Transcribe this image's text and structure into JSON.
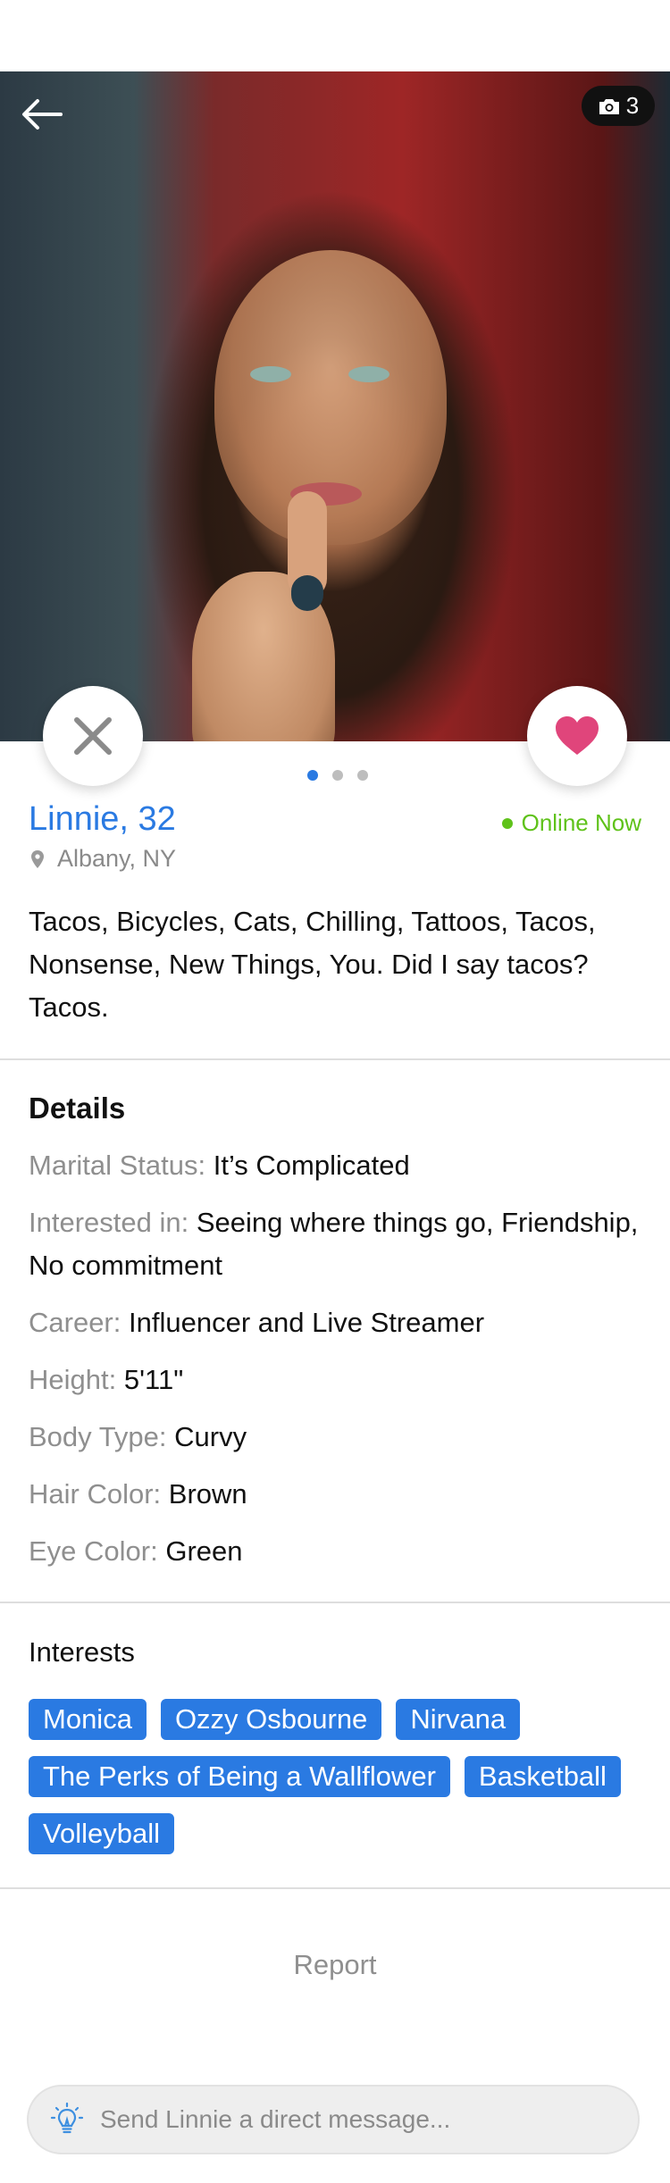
{
  "photo": {
    "count": "3",
    "current_index": 1,
    "total": 3
  },
  "profile": {
    "name_age": "Linnie, 32",
    "status": "Online Now",
    "location": "Albany, NY",
    "bio": "Tacos, Bicycles, Cats, Chilling, Tattoos, Tacos, Nonsense, New Things, You. Did I say tacos? Tacos."
  },
  "details": {
    "title": "Details",
    "items": [
      {
        "label": "Marital Status:",
        "value": "It’s Complicated"
      },
      {
        "label": "Interested in:",
        "value": "Seeing where things go, Friendship, No commitment"
      },
      {
        "label": "Career:",
        "value": "Influencer and Live Streamer"
      },
      {
        "label": "Height:",
        "value": "5'11\""
      },
      {
        "label": "Body Type:",
        "value": "Curvy"
      },
      {
        "label": "Hair Color:",
        "value": "Brown"
      },
      {
        "label": "Eye Color:",
        "value": "Green"
      }
    ]
  },
  "interests": {
    "title": "Interests",
    "tags": [
      "Monica",
      "Ozzy Osbourne",
      "Nirvana",
      "The Perks of Being a Wallflower",
      "Basketball",
      "Volleyball"
    ]
  },
  "report_label": "Report",
  "message": {
    "placeholder": "Send Linnie a direct message..."
  },
  "colors": {
    "accent": "#2a7ae2",
    "online": "#5fc21a",
    "like": "#e0457b"
  },
  "icons": {
    "back": "arrow-left-icon",
    "camera": "camera-icon",
    "pass": "close-x-icon",
    "like": "heart-icon",
    "location": "map-pin-icon",
    "hint": "lightbulb-icon"
  }
}
